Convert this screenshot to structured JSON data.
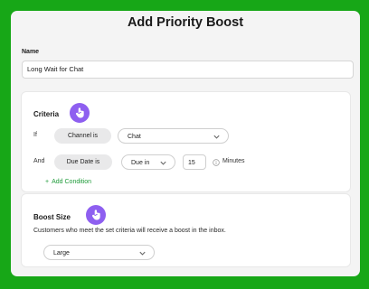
{
  "dialog": {
    "title": "Add Priority Boost",
    "name_label": "Name",
    "name_value": "Long Wait for Chat"
  },
  "criteria": {
    "title": "Criteria",
    "row1": {
      "prefix": "If",
      "field": "Channel is",
      "value": "Chat"
    },
    "row2": {
      "prefix": "And",
      "field": "Due Date is",
      "operator": "Due in",
      "amount": "15",
      "unit": "Minutes"
    },
    "add_condition": "Add Condition"
  },
  "boost": {
    "title": "Boost Size",
    "description": "Customers who meet the set criteria will receive a boost in the inbox.",
    "size_value": "Large"
  },
  "colors": {
    "background": "#17a717",
    "accent": "#8e5ff0",
    "link": "#1f9b3a"
  },
  "icons": [
    "hand-pointer-icon",
    "chevron-down-icon",
    "info-icon",
    "plus-icon"
  ]
}
